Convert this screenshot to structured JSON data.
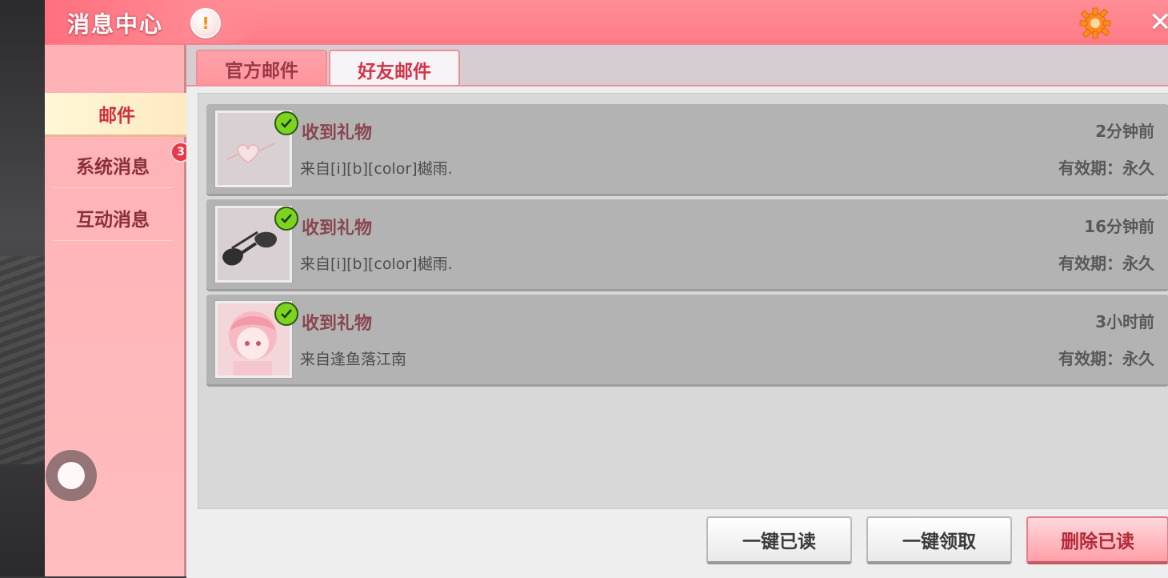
{
  "header": {
    "title": "消息中心",
    "info_icon_glyph": "!",
    "close_glyph": "✕"
  },
  "sidebar": {
    "items": [
      {
        "label": "邮件",
        "active": true
      },
      {
        "label": "系统消息",
        "badge": "3"
      },
      {
        "label": "互动消息"
      }
    ]
  },
  "tabs": [
    {
      "label": "官方邮件",
      "active": false
    },
    {
      "label": "好友邮件",
      "active": true
    }
  ],
  "mails": [
    {
      "title": "收到礼物",
      "from": "来自[i][b][color]樾雨.",
      "time": "2分钟前",
      "expiry": "有效期：永久",
      "item_icon": "heart-glasses-icon",
      "checked": true
    },
    {
      "title": "收到礼物",
      "from": "来自[i][b][color]樾雨.",
      "time": "16分钟前",
      "expiry": "有效期：永久",
      "item_icon": "sunglasses-icon",
      "checked": true
    },
    {
      "title": "收到礼物",
      "from": "来自逢鱼落江南",
      "time": "3小时前",
      "expiry": "有效期：永久",
      "item_icon": "avatar-portrait-icon",
      "checked": true
    }
  ],
  "actions": {
    "mark_all_read": "一键已读",
    "claim_all": "一键领取",
    "delete_read": "删除已读"
  },
  "colors": {
    "header": "#ff7b86",
    "sidebar": "#ffb2b6",
    "accent": "#d2354a",
    "check": "#7ed321"
  }
}
